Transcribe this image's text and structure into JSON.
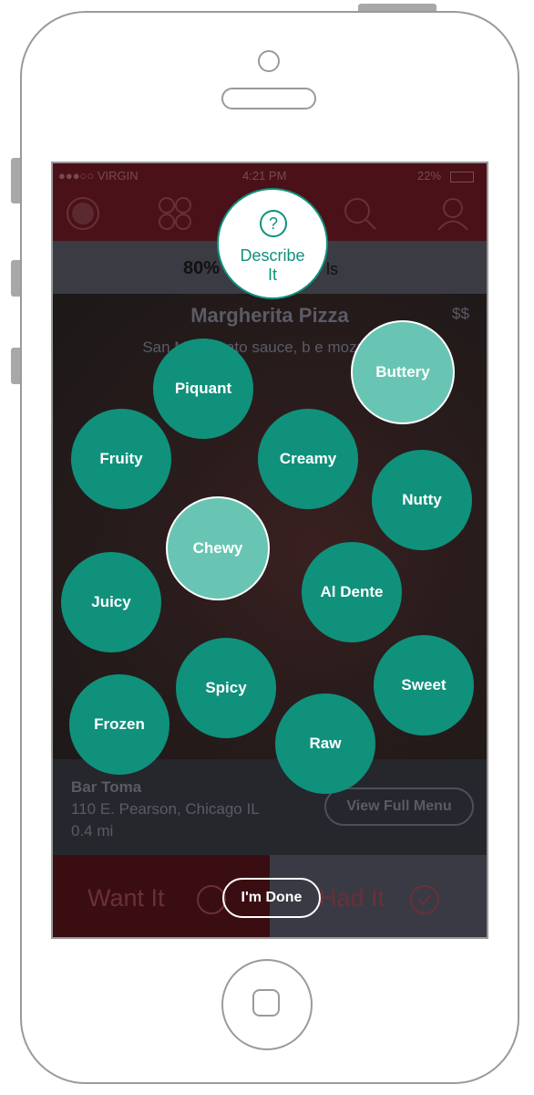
{
  "status": {
    "carrier": "●●●○○ VIRGIN",
    "time": "4:21 PM",
    "battery": "22%"
  },
  "stats": {
    "percent": "80%",
    "suffix": "ls"
  },
  "dish": {
    "title": "Margherita Pizza",
    "price": "$$",
    "description": "San Ma   tomato sauce, b       e mozzarella"
  },
  "venue": {
    "name": "Bar Toma",
    "address": "110 E. Pearson, Chicago IL",
    "distance": "0.4 mi",
    "menu_button": "View Full Menu"
  },
  "actions": {
    "want": "Want It",
    "had": "Had It",
    "done": "I'm Done"
  },
  "describe": {
    "label_line1": "Describe",
    "label_line2": "It",
    "icon": "?"
  },
  "tags": [
    {
      "label": "Piquant",
      "selected": false
    },
    {
      "label": "Buttery",
      "selected": true
    },
    {
      "label": "Fruity",
      "selected": false
    },
    {
      "label": "Creamy",
      "selected": false
    },
    {
      "label": "Nutty",
      "selected": false
    },
    {
      "label": "Chewy",
      "selected": true
    },
    {
      "label": "Juicy",
      "selected": false
    },
    {
      "label": "Al Dente",
      "selected": false
    },
    {
      "label": "Spicy",
      "selected": false
    },
    {
      "label": "Sweet",
      "selected": false
    },
    {
      "label": "Frozen",
      "selected": false
    },
    {
      "label": "Raw",
      "selected": false
    }
  ],
  "colors": {
    "bubble": "#10917c",
    "bubble_selected": "#68c5b4",
    "topbar": "#4a1218"
  }
}
